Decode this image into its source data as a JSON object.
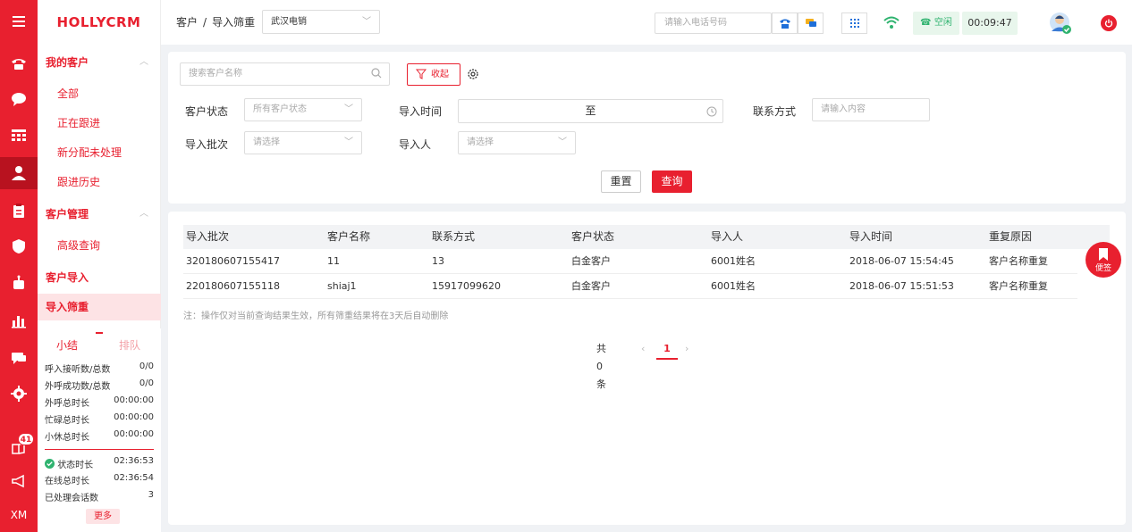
{
  "brand": "HOLLYCRM",
  "rail": {
    "active_index": 5,
    "badge": "41",
    "footer_text": "XM",
    "items": [
      "menu-icon",
      "phone-icon",
      "chat-icon",
      "grid-icon",
      "user-icon",
      "clipboard-icon",
      "shield-icon",
      "robot-icon",
      "bar-chart-icon",
      "comment-icon",
      "gear-icon",
      "book-icon",
      "megaphone-icon"
    ]
  },
  "menu": {
    "groups": [
      {
        "label": "我的客户",
        "items": [
          "全部",
          "正在跟进",
          "新分配未处理",
          "跟进历史"
        ]
      },
      {
        "label": "客户管理",
        "items": [
          "高级查询"
        ]
      },
      {
        "label": "客户导入",
        "items": []
      },
      {
        "label": "导入筛重",
        "items": []
      }
    ]
  },
  "stats": {
    "tab_summary": "小结",
    "tab_queue": "排队",
    "rows": [
      {
        "k": "呼入接听数/总数",
        "v": "0/0"
      },
      {
        "k": "外呼成功数/总数",
        "v": "0/0"
      },
      {
        "k": "外呼总时长",
        "v": "00:00:00"
      },
      {
        "k": "忙碌总时长",
        "v": "00:00:00"
      },
      {
        "k": "小休总时长",
        "v": "00:00:00"
      }
    ],
    "rows2": [
      {
        "k": "状态时长",
        "v": "02:36:53"
      },
      {
        "k": "在线总时长",
        "v": "02:36:54"
      },
      {
        "k": "已处理会话数",
        "v": "3"
      }
    ],
    "more": "更多"
  },
  "header": {
    "crumb_parent": "客户",
    "crumb_sep": "/",
    "crumb_current": "导入筛重",
    "org_select": "武汉电销",
    "phone_placeholder": "请输入电话号码",
    "status": "空闲",
    "timer": "00:09:47"
  },
  "filter": {
    "search_placeholder": "搜索客户名称",
    "collapse": "收起",
    "customer_status_label": "客户状态",
    "customer_status_placeholder": "所有客户状态",
    "import_time_label": "导入时间",
    "date_sep": "至",
    "contact_label": "联系方式",
    "contact_placeholder": "请输入内容",
    "batch_label": "导入批次",
    "batch_placeholder": "请选择",
    "importer_label": "导入人",
    "importer_placeholder": "请选择",
    "reset": "重置",
    "query": "查询"
  },
  "table": {
    "columns": [
      "导入批次",
      "客户名称",
      "联系方式",
      "客户状态",
      "导入人",
      "导入时间",
      "重复原因"
    ],
    "rows": [
      [
        "320180607155417",
        "11",
        "13",
        "白金客户",
        "6001姓名",
        "2018-06-07 15:54:45",
        "客户名称重复"
      ],
      [
        "220180607155118",
        "shiaj1",
        "15917099620",
        "白金客户",
        "6001姓名",
        "2018-06-07 15:51:53",
        "客户名称重复"
      ]
    ],
    "note": "注：操作仅对当前查询结果生效，所有筛重结果将在3天后自动删除"
  },
  "pager": {
    "total": "共 0 条",
    "prev": "‹",
    "current": "1",
    "next": "›"
  },
  "sticky_note": "便签",
  "colors": {
    "brand": "#e8202f",
    "active_bg": "#fde3e5",
    "status_green": "#2fb36f"
  }
}
